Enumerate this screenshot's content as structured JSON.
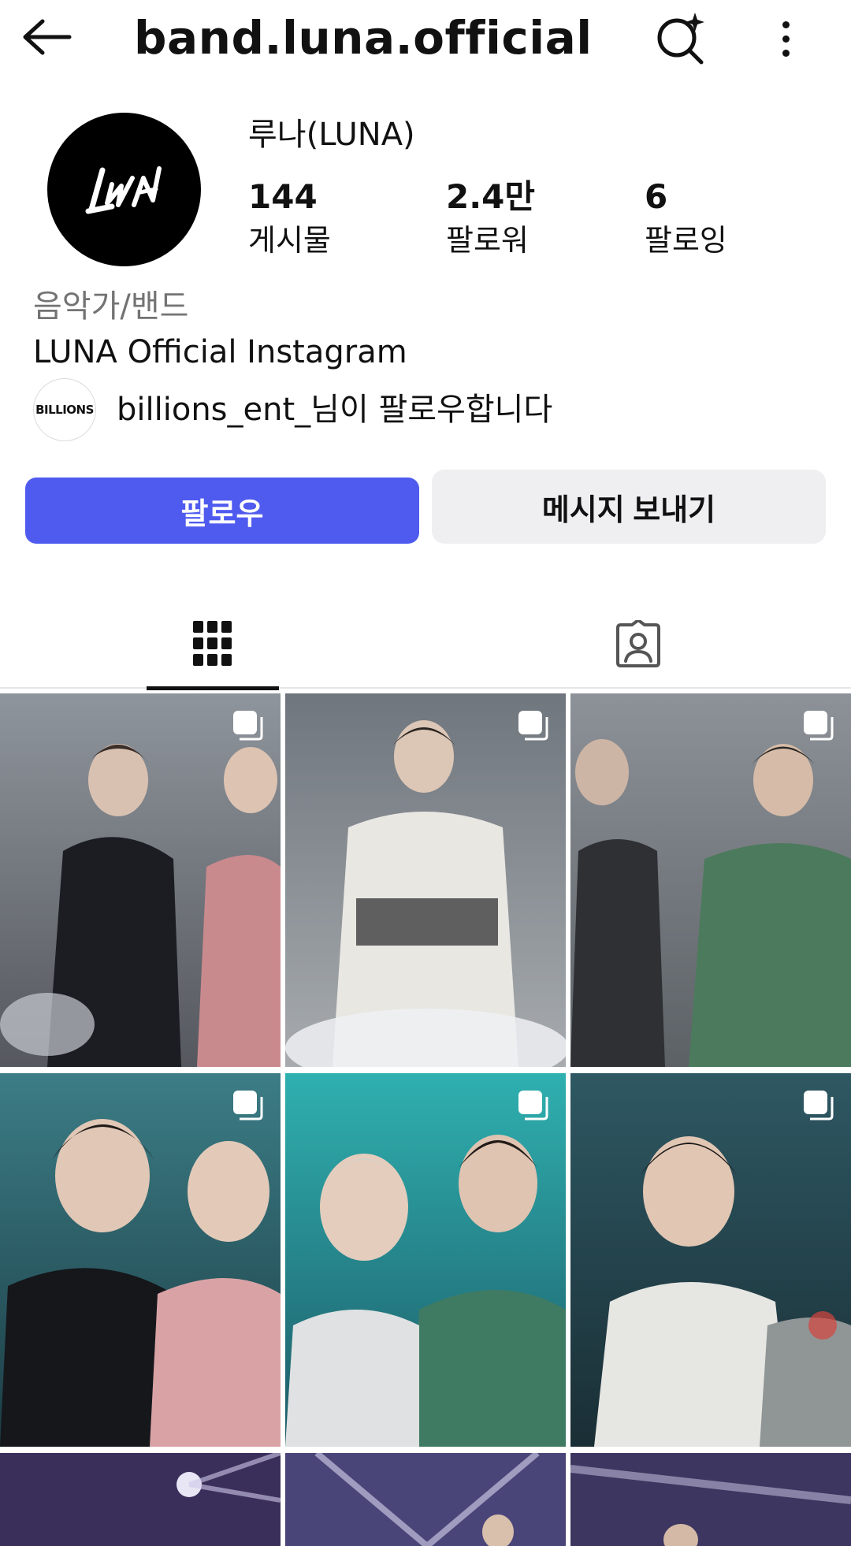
{
  "header": {
    "username": "band.luna.official",
    "back_icon": "arrow-left-icon",
    "search_icon": "search-sparkle-icon",
    "more_icon": "more-vertical-icon"
  },
  "profile": {
    "avatar_text": "LUNA",
    "display_name": "루나(LUNA)",
    "stats": {
      "posts": {
        "value": "144",
        "label": "게시물"
      },
      "followers": {
        "value": "2.4만",
        "label": "팔로워"
      },
      "following": {
        "value": "6",
        "label": "팔로잉"
      }
    },
    "category": "음악가/밴드",
    "bio": "LUNA Official Instagram",
    "followed_by": {
      "avatar_text": "BILLIONS",
      "username": "billions_ent_",
      "suffix": "님이 팔로우합니다"
    }
  },
  "actions": {
    "follow_label": "팔로우",
    "message_label": "메시지 보내기"
  },
  "colors": {
    "follow_button": "#4f5bef",
    "message_button": "#efeff2",
    "secondary_text": "#737373"
  },
  "tabs": [
    {
      "name": "grid",
      "icon": "grid-icon",
      "active": true
    },
    {
      "name": "tagged",
      "icon": "tagged-person-icon",
      "active": false
    }
  ],
  "posts": [
    {
      "icon": "carousel-icon"
    },
    {
      "icon": "carousel-icon"
    },
    {
      "icon": "carousel-icon"
    },
    {
      "icon": "carousel-icon"
    },
    {
      "icon": "carousel-icon"
    },
    {
      "icon": "carousel-icon"
    },
    {
      "icon": ""
    },
    {
      "icon": ""
    },
    {
      "icon": ""
    }
  ]
}
